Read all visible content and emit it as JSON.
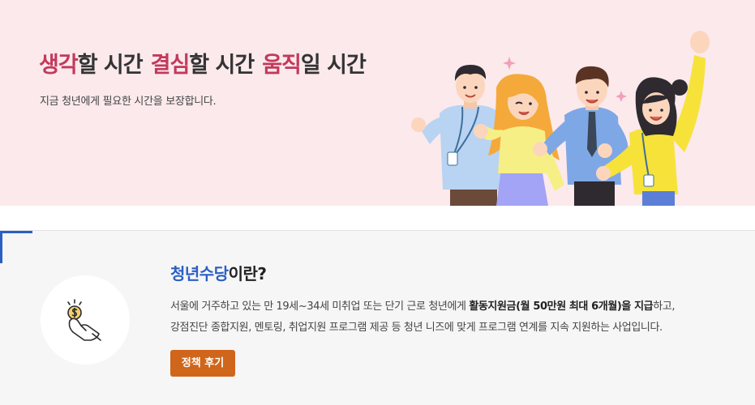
{
  "hero": {
    "title": {
      "part1_accent": "생각",
      "part1_rest": "할 시간",
      "part2_accent": "결심",
      "part2_rest": "할 시간",
      "part3_accent": "움직",
      "part3_rest": "일 시간"
    },
    "subtitle": "지금 청년에게 필요한 시간을 보장합니다."
  },
  "info": {
    "title_highlight": "청년수당",
    "title_rest": "이란?",
    "line1_before": "서울에 거주하고 있는 만 19세~34세 미취업 또는 단기 근로 청년에게 ",
    "line1_bold": "활동지원금(월 50만원 최대 6개월)을 지급",
    "line1_after": "하고,",
    "line2": "강점진단 종합지원, 멘토링, 취업지원 프로그램 제공 등 청년 니즈에 맞게 프로그램 연계를 지속 지원하는 사업입니다.",
    "button_label": "정책 후기",
    "icon": "hand-holding-coin-icon"
  },
  "colors": {
    "hero_bg": "#fbe9ec",
    "accent_pink": "#c2395b",
    "accent_blue": "#2b5fc4",
    "button_orange": "#d0661b",
    "info_bg": "#f6f6f6"
  }
}
